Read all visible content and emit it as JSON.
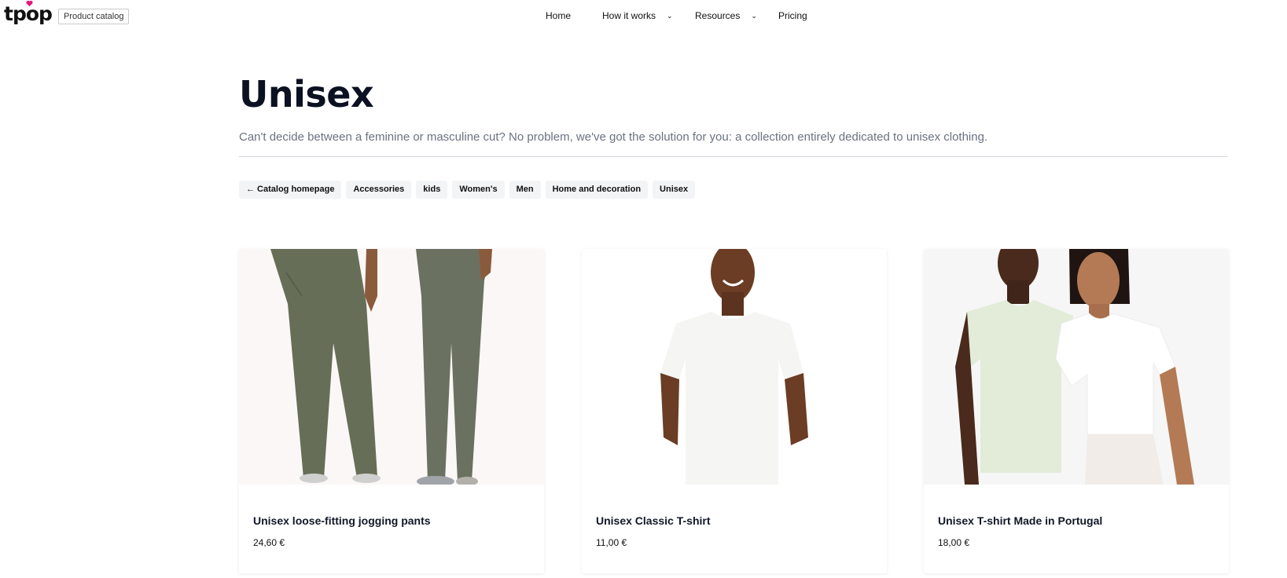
{
  "header": {
    "logo_text": "tpop",
    "badge": "Product catalog",
    "nav": [
      {
        "label": "Home",
        "dropdown": false
      },
      {
        "label": "How it works",
        "dropdown": true
      },
      {
        "label": "Resources",
        "dropdown": true
      },
      {
        "label": "Pricing",
        "dropdown": false
      }
    ]
  },
  "page": {
    "title": "Unisex",
    "subtitle": "Can't decide between a feminine or masculine cut? No problem, we've got the solution for you: a collection entirely dedicated to unisex clothing."
  },
  "categories": [
    "← Catalog homepage",
    "Accessories",
    "kids",
    "Women's",
    "Men",
    "Home and decoration",
    "Unisex"
  ],
  "products": [
    {
      "name": "Unisex loose-fitting jogging pants",
      "price": "24,60 €",
      "image": "khaki-jogging-pants-photo"
    },
    {
      "name": "Unisex Classic T-shirt",
      "price": "11,00 €",
      "image": "white-tshirt-man-photo"
    },
    {
      "name": "Unisex T-shirt Made in Portugal",
      "price": "18,00 €",
      "image": "couple-tshirts-photo"
    }
  ],
  "colors": {
    "brand_pink": "#e6177a",
    "chip_bg": "#f3f4f6",
    "text_dark": "#0b1120",
    "text_muted": "#6b7280"
  }
}
